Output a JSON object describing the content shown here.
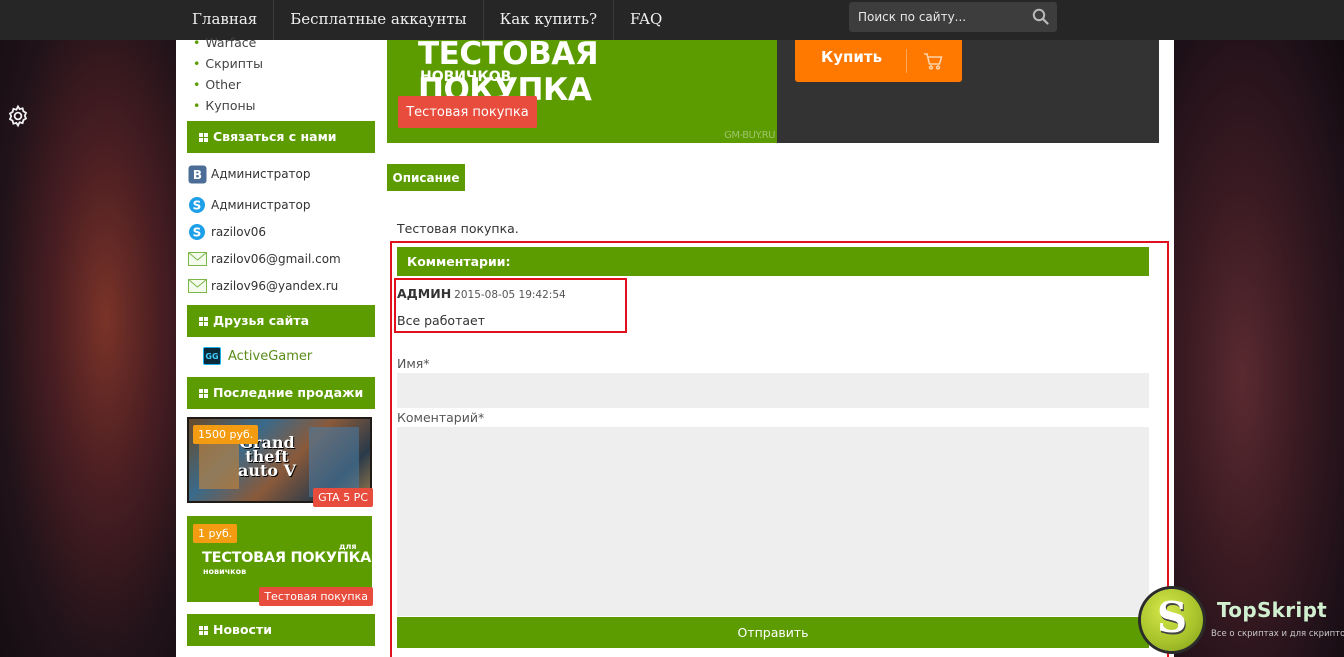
{
  "nav": {
    "items": [
      "Главная",
      "Бесплатные аккаунты",
      "Как купить?",
      "FAQ"
    ],
    "search_placeholder": "Поиск по сайту..."
  },
  "sidebar": {
    "categories": [
      "Warface",
      "Скрипты",
      "Other",
      "Купоны"
    ],
    "contact_title": "Связаться с нами",
    "contacts": [
      {
        "icon": "vk-icon",
        "label": "Администратор"
      },
      {
        "icon": "skype-icon",
        "label": "Администратор"
      },
      {
        "icon": "skype-icon",
        "label": "razilov06"
      },
      {
        "icon": "mail-icon",
        "label": "razilov06@gmail.com"
      },
      {
        "icon": "mail-icon",
        "label": "razilov96@yandex.ru"
      }
    ],
    "friends_title": "Друзья сайта",
    "friend": {
      "badge": "GG",
      "label": "ActiveGamer"
    },
    "sales_title": "Последние продажи",
    "sales": [
      {
        "price": "1500 руб.",
        "label": "GTA 5 PC",
        "art_text": "Grand theft auto V"
      },
      {
        "price": "1 руб.",
        "label": "Тестовая покупка",
        "art_title": "ТЕСТОВАЯ ПОКУПКА",
        "art_small": "для",
        "art_sub": "новичков"
      }
    ],
    "news_title": "Новости"
  },
  "banner": {
    "title": "ТЕСТОВАЯ ПОКУПКА",
    "subtitle": "НОВИЧКОВ",
    "button": "Тестовая покупка",
    "watermark": "GM-BUY.RU",
    "buy_button": "Купить"
  },
  "tabs": {
    "description": "Описание"
  },
  "description_text": "Тестовая покупка.",
  "comments": {
    "title": "Комментарии:",
    "items": [
      {
        "author": "АДМИН",
        "date": "2015-08-05 19:42:54",
        "text": "Все работает"
      }
    ],
    "name_label": "Имя*",
    "comment_label": "Коментарий*",
    "submit": "Отправить"
  },
  "watermark": {
    "letter": "S",
    "name": "TopSkript",
    "tagline": "Все о скриптах и для скриптов..."
  },
  "colors": {
    "green": "#5c9c00",
    "orange": "#ff7800",
    "red": "#e74c3c",
    "dark": "#262626"
  }
}
